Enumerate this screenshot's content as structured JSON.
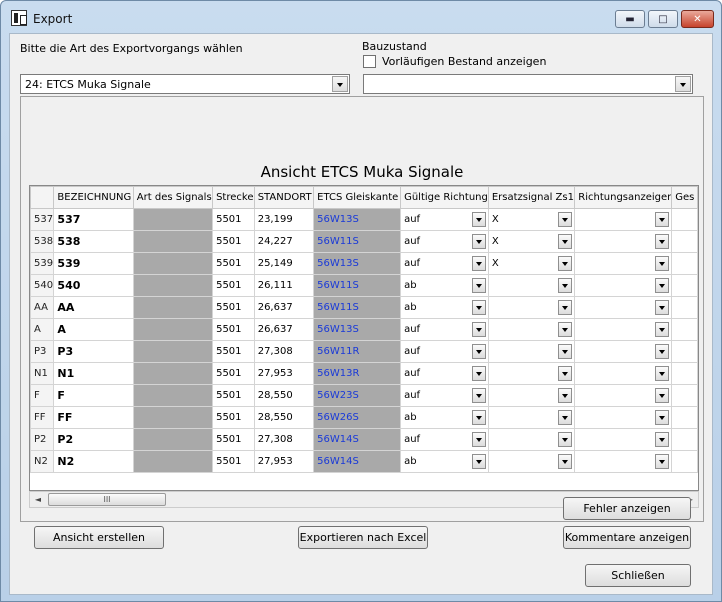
{
  "window": {
    "title": "Export"
  },
  "top": {
    "mode_label": "Bitte die Art des Exportvorgangs wählen",
    "mode_value": "24: ETCS Muka Signale",
    "bauzustand_label": "Bauzustand",
    "checkbox_label": "Vorläufigen Bestand anzeigen",
    "checkbox_checked": false,
    "bauzustand_value": ""
  },
  "view": {
    "title": "Ansicht ETCS Muka Signale",
    "columns": [
      "BEZEICHNUNG",
      "Art des Signals",
      "Strecke",
      "STANDORT",
      "ETCS Gleiskante",
      "Gültige Richtung",
      "Ersatzsignal Zs1",
      "Richtungsanzeiger",
      "Ges"
    ],
    "rows": [
      {
        "hdr": "537",
        "bez": "537",
        "art": "",
        "strecke": "5501",
        "standort": "23,199",
        "gleis": "56W13S",
        "richt": "auf",
        "zs1": "X",
        "ra": ""
      },
      {
        "hdr": "538",
        "bez": "538",
        "art": "",
        "strecke": "5501",
        "standort": "24,227",
        "gleis": "56W11S",
        "richt": "auf",
        "zs1": "X",
        "ra": ""
      },
      {
        "hdr": "539",
        "bez": "539",
        "art": "",
        "strecke": "5501",
        "standort": "25,149",
        "gleis": "56W13S",
        "richt": "auf",
        "zs1": "X",
        "ra": ""
      },
      {
        "hdr": "540",
        "bez": "540",
        "art": "",
        "strecke": "5501",
        "standort": "26,111",
        "gleis": "56W11S",
        "richt": "ab",
        "zs1": "",
        "ra": ""
      },
      {
        "hdr": "AA",
        "bez": "AA",
        "art": "",
        "strecke": "5501",
        "standort": "26,637",
        "gleis": "56W11S",
        "richt": "ab",
        "zs1": "",
        "ra": ""
      },
      {
        "hdr": "A",
        "bez": "A",
        "art": "",
        "strecke": "5501",
        "standort": "26,637",
        "gleis": "56W13S",
        "richt": "auf",
        "zs1": "",
        "ra": ""
      },
      {
        "hdr": "P3",
        "bez": "P3",
        "art": "",
        "strecke": "5501",
        "standort": "27,308",
        "gleis": "56W11R",
        "richt": "auf",
        "zs1": "",
        "ra": ""
      },
      {
        "hdr": "N1",
        "bez": "N1",
        "art": "",
        "strecke": "5501",
        "standort": "27,953",
        "gleis": "56W13R",
        "richt": "auf",
        "zs1": "",
        "ra": ""
      },
      {
        "hdr": "F",
        "bez": "F",
        "art": "",
        "strecke": "5501",
        "standort": "28,550",
        "gleis": "56W23S",
        "richt": "auf",
        "zs1": "",
        "ra": ""
      },
      {
        "hdr": "FF",
        "bez": "FF",
        "art": "",
        "strecke": "5501",
        "standort": "28,550",
        "gleis": "56W26S",
        "richt": "ab",
        "zs1": "",
        "ra": ""
      },
      {
        "hdr": "P2",
        "bez": "P2",
        "art": "",
        "strecke": "5501",
        "standort": "27,308",
        "gleis": "56W14S",
        "richt": "auf",
        "zs1": "",
        "ra": ""
      },
      {
        "hdr": "N2",
        "bez": "N2",
        "art": "",
        "strecke": "5501",
        "standort": "27,953",
        "gleis": "56W14S",
        "richt": "ab",
        "zs1": "",
        "ra": ""
      }
    ]
  },
  "scrollbar": {
    "thumb_glyph": "III",
    "left_arrow": "◄",
    "right_arrow": "►"
  },
  "buttons": {
    "fehler": "Fehler anzeigen",
    "ansicht": "Ansicht erstellen",
    "excel": "Exportieren nach Excel",
    "kommentare": "Kommentare anzeigen",
    "schliessen": "Schließen"
  },
  "window_buttons": {
    "minimize": "▬",
    "maximize": "□",
    "close": "✕"
  }
}
